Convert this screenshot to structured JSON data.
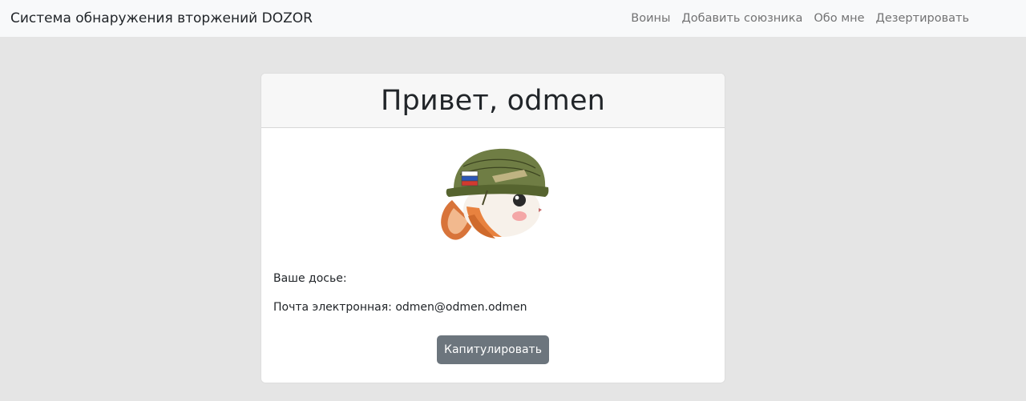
{
  "navbar": {
    "brand": "Система обнаружения вторжений DOZOR",
    "links": [
      "Воины",
      "Добавить союзника",
      "Обо мне",
      "Дезертировать"
    ]
  },
  "card": {
    "greeting": "Привет, odmen",
    "avatar_icon": "hamster-in-helmet-icon",
    "dossier_label": "Ваше досье:",
    "email_label": "Почта электронная:",
    "email_value": "odmen@odmen.odmen",
    "capitulate_button": "Капитулировать"
  }
}
